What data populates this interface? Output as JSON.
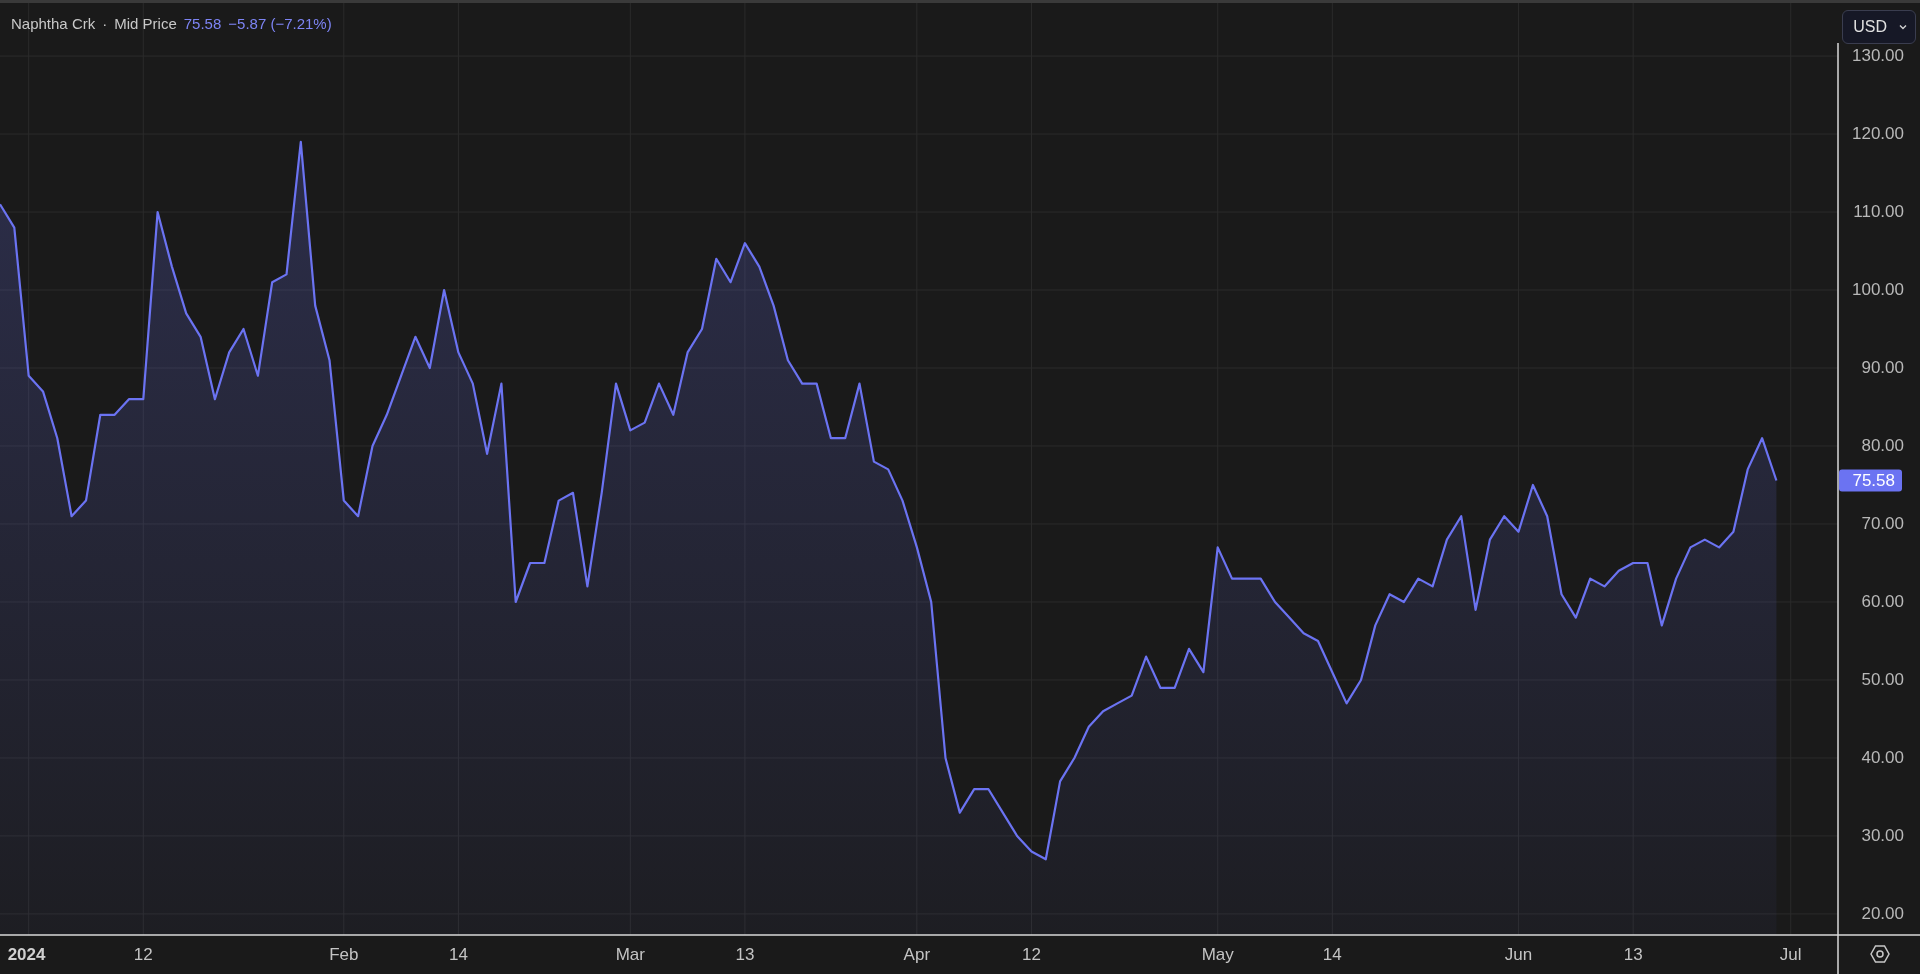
{
  "header": {
    "symbol": "Naphtha Crk",
    "separator": "·",
    "last": "75.58",
    "change": "−5.87 (−7.21%)"
  },
  "currency_select": {
    "value": "USD"
  },
  "price_label": "75.58",
  "chart": {
    "chart_data": {
      "type": "area",
      "grid": true,
      "ylim": [
        17.3,
        136.8
      ],
      "yticks": [
        {
          "value": 20,
          "label": "20.00"
        },
        {
          "value": 30,
          "label": "30.00"
        },
        {
          "value": 40,
          "label": "40.00"
        },
        {
          "value": 50,
          "label": "50.00"
        },
        {
          "value": 60,
          "label": "60.00"
        },
        {
          "value": 70,
          "label": "70.00"
        },
        {
          "value": 80,
          "label": "80.00"
        },
        {
          "value": 90,
          "label": "90.00"
        },
        {
          "value": 100,
          "label": "100.00"
        },
        {
          "value": 110,
          "label": "110.00"
        },
        {
          "value": 120,
          "label": "120.00"
        },
        {
          "value": 130,
          "label": "130.00"
        }
      ],
      "categories": [
        null,
        null,
        "2024",
        null,
        null,
        null,
        null,
        null,
        null,
        null,
        "12",
        null,
        null,
        null,
        null,
        null,
        null,
        null,
        null,
        null,
        null,
        null,
        null,
        null,
        "Feb",
        null,
        null,
        null,
        null,
        null,
        null,
        null,
        "14",
        null,
        null,
        null,
        null,
        null,
        null,
        null,
        null,
        null,
        null,
        null,
        "Mar",
        null,
        null,
        null,
        null,
        null,
        null,
        null,
        "13",
        null,
        null,
        null,
        null,
        null,
        null,
        null,
        null,
        null,
        null,
        null,
        "Apr",
        null,
        null,
        null,
        null,
        null,
        null,
        null,
        "12",
        null,
        null,
        null,
        null,
        null,
        null,
        null,
        null,
        null,
        null,
        null,
        null,
        "May",
        null,
        null,
        null,
        null,
        null,
        null,
        null,
        "14",
        null,
        null,
        null,
        null,
        null,
        null,
        null,
        null,
        null,
        null,
        null,
        null,
        "Jun",
        null,
        null,
        null,
        null,
        null,
        null,
        null,
        "13",
        null,
        null,
        null,
        null,
        null,
        null,
        null,
        null,
        null,
        null,
        "Jul"
      ],
      "series": [
        {
          "name": "Mid Price",
          "color": "#6b73f2",
          "values": [
            111,
            108,
            89,
            87,
            81,
            71,
            73,
            84,
            84,
            86,
            86,
            110,
            103,
            97,
            94,
            86,
            92,
            95,
            89,
            101,
            102,
            119,
            98,
            91,
            73,
            71,
            80,
            84,
            89,
            94,
            90,
            100,
            92,
            88,
            79,
            88,
            60,
            65,
            65,
            73,
            74,
            62,
            74,
            88,
            82,
            83,
            88,
            84,
            92,
            95,
            104,
            101,
            106,
            103,
            98,
            91,
            88,
            88,
            81,
            81,
            88,
            78,
            77,
            73,
            67,
            60,
            40,
            33,
            36,
            36,
            33,
            30,
            28,
            27,
            37,
            40,
            44,
            46,
            47,
            48,
            53,
            49,
            49,
            54,
            51,
            67,
            63,
            63,
            63,
            60,
            58,
            56,
            55,
            51,
            47,
            50,
            57,
            61,
            60,
            63,
            62,
            68,
            71,
            59,
            68,
            71,
            69,
            75,
            71,
            61,
            58,
            63,
            62,
            64,
            65,
            65,
            57,
            63,
            67,
            68,
            67,
            69,
            77,
            81,
            75.58,
            null
          ]
        }
      ]
    }
  }
}
